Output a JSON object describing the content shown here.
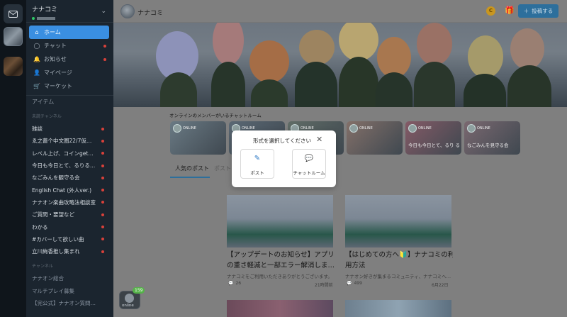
{
  "rail": {
    "mail_icon": "mail-icon"
  },
  "sidebar": {
    "community_name": "ナナコミ",
    "nav": [
      {
        "label": "ホーム",
        "icon": "home-icon",
        "glyph": "⌂",
        "active": true,
        "notify": false
      },
      {
        "label": "チャット",
        "icon": "chat-icon",
        "glyph": "◯",
        "active": false,
        "notify": true
      },
      {
        "label": "お知らせ",
        "icon": "bell-icon",
        "glyph": "🔔",
        "active": false,
        "notify": true
      },
      {
        "label": "マイページ",
        "icon": "user-icon",
        "glyph": "👤",
        "active": false,
        "notify": false
      },
      {
        "label": "マーケット",
        "icon": "cart-icon",
        "glyph": "🛒",
        "active": false,
        "notify": false
      }
    ],
    "section": "アイテム",
    "channels_caption": "未読チャンネル",
    "unread_channels": [
      {
        "label": "雑談"
      },
      {
        "label": "ゑ之蕾个中文圏22/7仮…"
      },
      {
        "label": "レベル上げ、コインget…"
      },
      {
        "label": "今日も今日とて、るりる…"
      },
      {
        "label": "なごみんを観守る会"
      },
      {
        "label": "English Chat (外人ver.)"
      },
      {
        "label": "ナナオン楽曲攻略法相談室"
      },
      {
        "label": "ご質問・要望など"
      },
      {
        "label": "わかる"
      },
      {
        "label": "#カバーして欲しい曲"
      },
      {
        "label": "立川絢香推し集まれ"
      }
    ],
    "channel_caption": "チャンネル",
    "channels": [
      {
        "label": "ナナオン総合"
      },
      {
        "label": "マルチプレイ募集"
      },
      {
        "label": "【完公式】ナナオン質問…"
      }
    ]
  },
  "topbar": {
    "title": "ナナコミ",
    "coin_glyph": "C",
    "post_button": "投稿する"
  },
  "rooms": {
    "label": "オンラインのメンバーがいるチャットルーム",
    "online_tag": "ONLINE",
    "items": [
      {
        "caption": "",
        "color": "#6a7a84"
      },
      {
        "caption": "",
        "color": "#5a6874"
      },
      {
        "caption": "",
        "color": "#606c66"
      },
      {
        "caption": "",
        "color": "#837069"
      },
      {
        "caption": "今日も今日とて、るり るりしちゃう会",
        "color": "#845a66"
      },
      {
        "caption": "なごみんを見守る会",
        "color": "#7a6870"
      }
    ]
  },
  "tabs": {
    "popular": "人気のポスト",
    "posts": "ポスト"
  },
  "cards": [
    {
      "title_line1": "【アップデートのお知らせ】アプリ",
      "title_line2": "の重さ軽減と一部エラー解消しま…",
      "desc": "ナナコミをご利用いただきありがとうございます。",
      "comments": "26",
      "date": "21時間前"
    },
    {
      "title_line1": "【はじめての方へ🔰】ナナコミの利",
      "title_line2": "用方法",
      "desc": "ナナオン好きが集まるコミュニティ、ナナコミへ…",
      "comments": "499",
      "date": "6月22日"
    }
  ],
  "modal": {
    "title": "形式を選択してください",
    "option_post": "ポスト",
    "option_chatroom": "チャットルーム"
  },
  "online_widget": {
    "count": "159",
    "label": "online"
  }
}
